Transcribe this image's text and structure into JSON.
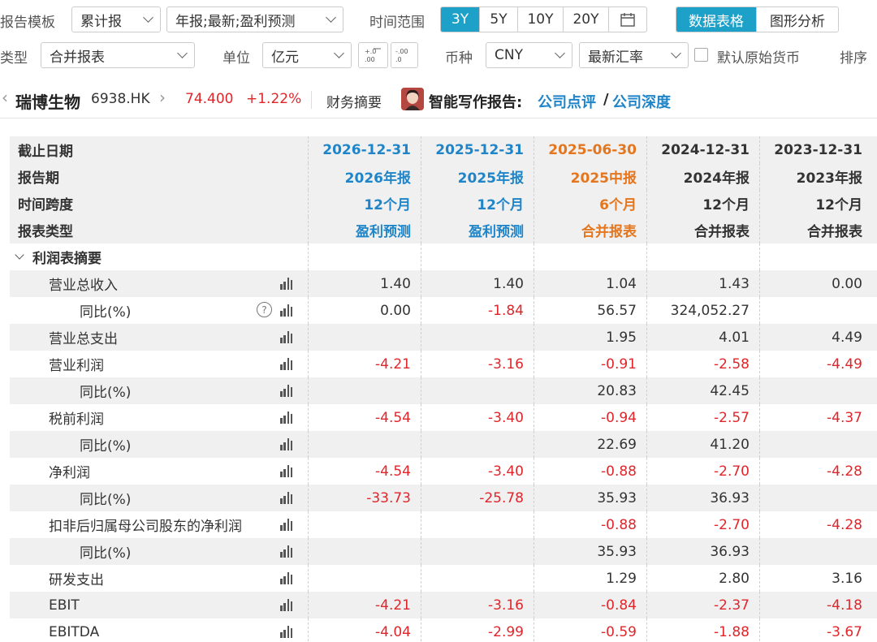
{
  "toolbar": {
    "report_template_label": "报告模板",
    "report_template_value": "累计报",
    "period_select_value": "年报;最新;盈利预测",
    "time_range_label": "时间范围",
    "ranges": [
      "3Y",
      "5Y",
      "10Y",
      "20Y"
    ],
    "active_range": "3Y",
    "view_tabs": [
      "数据表格",
      "图形分析"
    ],
    "active_view": "数据表格",
    "type_label": "类型",
    "type_value": "合并报表",
    "unit_label": "单位",
    "unit_value": "亿元",
    "currency_label": "币种",
    "currency_value": "CNY",
    "rate_value": "最新汇率",
    "default_currency_label": "默认原始货币",
    "sort_label": "排序",
    "decimal_increase": "+.0 .00",
    "decimal_decrease": "-.00 .0"
  },
  "stock": {
    "name": "瑞博生物",
    "code": "6938.HK",
    "price": "74.400",
    "change": "+1.22%",
    "summary_label": "财务摘要",
    "ai_label": "智能写作报告:",
    "link1": "公司点评",
    "sep": "/",
    "link2": "公司深度"
  },
  "table": {
    "header_rows": [
      {
        "label": "截止日期",
        "cells": [
          "2026-12-31",
          "2025-12-31",
          "2025-06-30",
          "2024-12-31",
          "2023-12-31"
        ]
      },
      {
        "label": "报告期",
        "cells": [
          "2026年报",
          "2025年报",
          "2025中报",
          "2024年报",
          "2023年报"
        ]
      },
      {
        "label": "时间跨度",
        "cells": [
          "12个月",
          "12个月",
          "6个月",
          "12个月",
          "12个月"
        ]
      },
      {
        "label": "报表类型",
        "cells": [
          "盈利预测",
          "盈利预测",
          "合并报表",
          "合并报表",
          "合并报表"
        ]
      }
    ],
    "column_colors": [
      "blue",
      "blue",
      "orange",
      "black",
      "black"
    ],
    "section_title": "利润表摘要",
    "rows": [
      {
        "label": "营业总收入",
        "indent": 1,
        "cells": [
          "1.40",
          "1.40",
          "1.04",
          "1.43",
          "0.00"
        ]
      },
      {
        "label": "同比(%)",
        "indent": 2,
        "help": true,
        "cells": [
          "0.00",
          "-1.84",
          "56.57",
          "324,052.27",
          ""
        ]
      },
      {
        "label": "营业总支出",
        "indent": 1,
        "cells": [
          "",
          "",
          "1.95",
          "4.01",
          "4.49"
        ]
      },
      {
        "label": "营业利润",
        "indent": 1,
        "cells": [
          "-4.21",
          "-3.16",
          "-0.91",
          "-2.58",
          "-4.49"
        ]
      },
      {
        "label": "同比(%)",
        "indent": 2,
        "cells": [
          "",
          "",
          "20.83",
          "42.45",
          ""
        ]
      },
      {
        "label": "税前利润",
        "indent": 1,
        "cells": [
          "-4.54",
          "-3.40",
          "-0.94",
          "-2.57",
          "-4.37"
        ]
      },
      {
        "label": "同比(%)",
        "indent": 2,
        "cells": [
          "",
          "",
          "22.69",
          "41.20",
          ""
        ]
      },
      {
        "label": "净利润",
        "indent": 1,
        "cells": [
          "-4.54",
          "-3.40",
          "-0.88",
          "-2.70",
          "-4.28"
        ]
      },
      {
        "label": "同比(%)",
        "indent": 2,
        "cells": [
          "-33.73",
          "-25.78",
          "35.93",
          "36.93",
          ""
        ]
      },
      {
        "label": "扣非后归属母公司股东的净利润",
        "indent": 1,
        "cells": [
          "",
          "",
          "-0.88",
          "-2.70",
          "-4.28"
        ]
      },
      {
        "label": "同比(%)",
        "indent": 2,
        "cells": [
          "",
          "",
          "35.93",
          "36.93",
          ""
        ]
      },
      {
        "label": "研发支出",
        "indent": 1,
        "cells": [
          "",
          "",
          "1.29",
          "2.80",
          "3.16"
        ]
      },
      {
        "label": "EBIT",
        "indent": 1,
        "cells": [
          "-4.21",
          "-3.16",
          "-0.84",
          "-2.37",
          "-4.18"
        ]
      },
      {
        "label": "EBITDA",
        "indent": 1,
        "cells": [
          "-4.04",
          "-2.99",
          "-0.59",
          "-1.88",
          "-3.67"
        ]
      }
    ]
  }
}
